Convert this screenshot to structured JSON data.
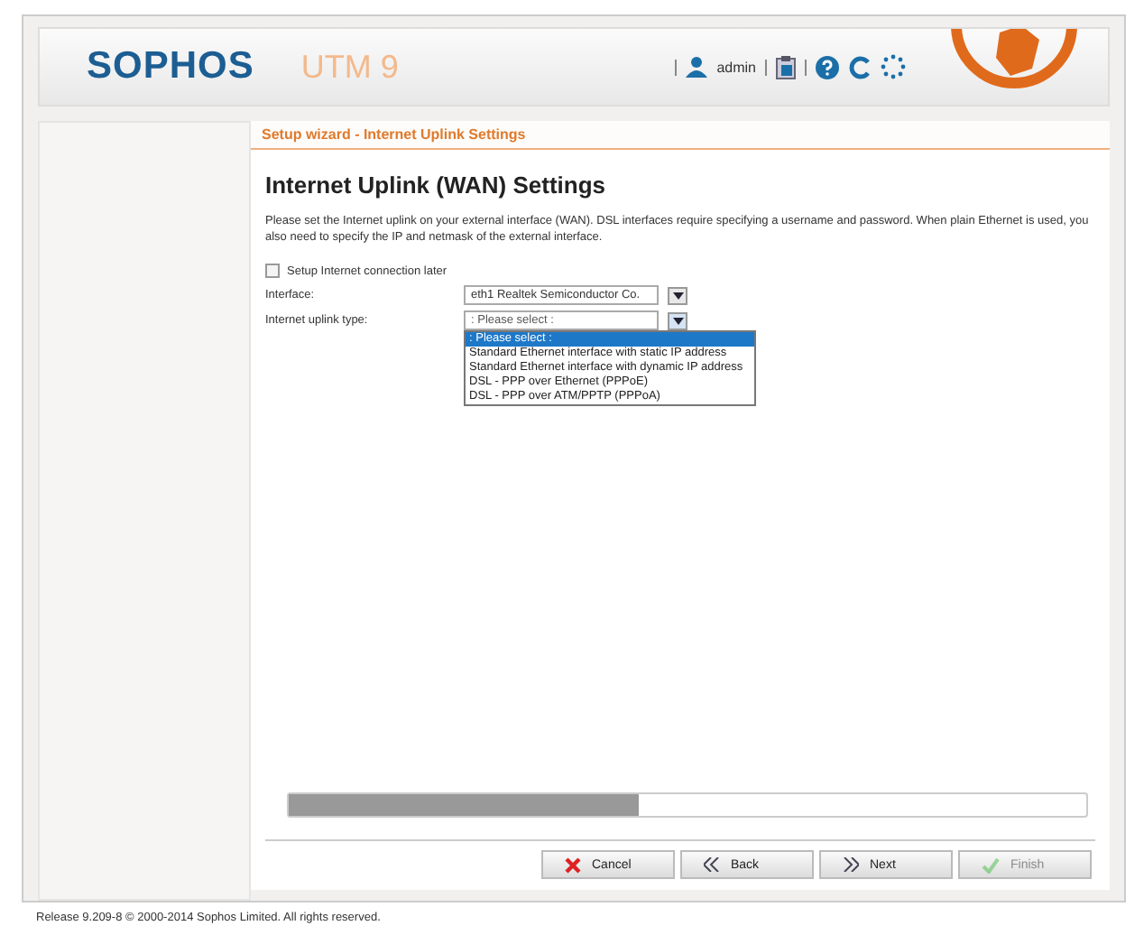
{
  "header": {
    "logo": "SOPHOS",
    "product": "UTM 9",
    "user": "admin"
  },
  "wizard": {
    "breadcrumb": "Setup wizard - Internet Uplink Settings",
    "title": "Internet Uplink (WAN) Settings",
    "description": "Please set the Internet uplink on your external interface (WAN). DSL interfaces require specifying a username and password. When plain Ethernet is used, you also need to specify the IP and netmask of the external interface.",
    "later": {
      "label": "Setup Internet connection later",
      "checked": false
    },
    "interface": {
      "label": "Interface:",
      "value": "eth1 Realtek Semiconductor Co."
    },
    "uplink": {
      "label": "Internet uplink type:",
      "value": ": Please select :",
      "expanded": true,
      "options": [
        {
          "label": ": Please select :",
          "selected": true
        },
        {
          "label": "Standard Ethernet interface with static IP address",
          "selected": false
        },
        {
          "label": "Standard Ethernet interface with dynamic IP address",
          "selected": false
        },
        {
          "label": "DSL - PPP over Ethernet (PPPoE)",
          "selected": false
        },
        {
          "label": "DSL - PPP over ATM/PPTP (PPPoA)",
          "selected": false
        }
      ]
    },
    "progress": {
      "level": 0.44
    },
    "buttons": [
      {
        "kind": "cancel",
        "label": "Cancel",
        "disabled": false
      },
      {
        "kind": "back",
        "label": "Back",
        "disabled": false
      },
      {
        "kind": "next",
        "label": "Next",
        "disabled": false
      },
      {
        "kind": "finish",
        "label": "Finish",
        "disabled": true
      }
    ]
  },
  "status_bar": "Release 9.209-8  © 2000-2014 Sophos Limited. All rights reserved."
}
